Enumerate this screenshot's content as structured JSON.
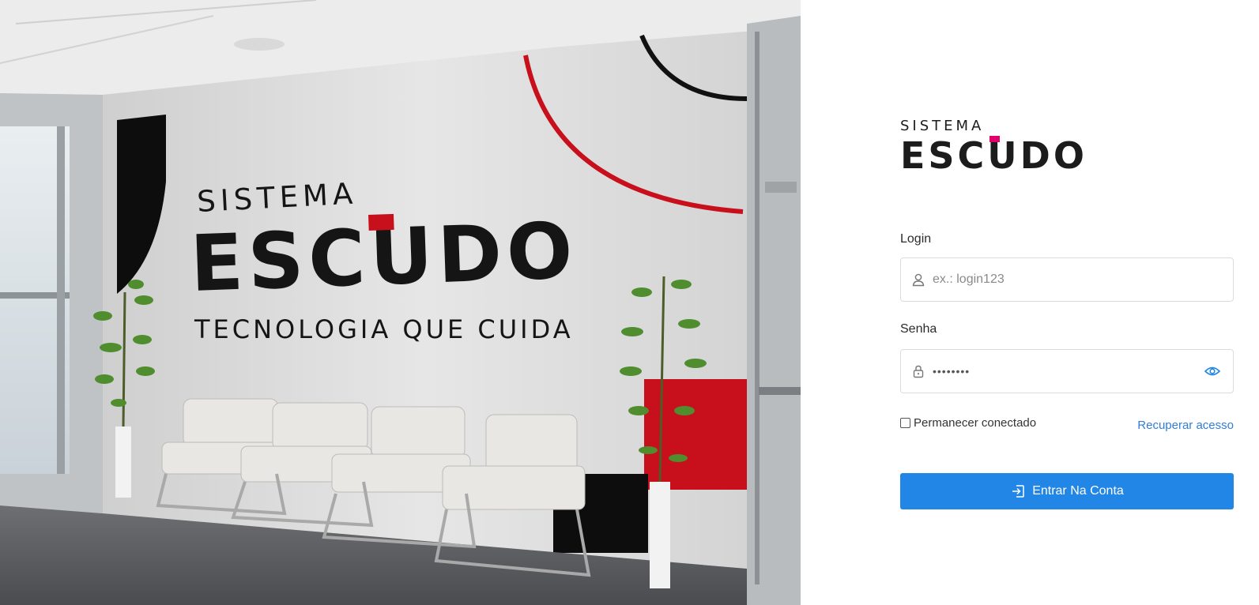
{
  "hero": {
    "wall_brand_small": "SISTEMA",
    "wall_brand_big": "ESCUDO",
    "wall_tagline": "TECNOLOGIA QUE CUIDA",
    "accent_red": "#c8101c"
  },
  "brand": {
    "small": "SISTEMA",
    "big": "ESCUDO",
    "mark_color": "#e2006a"
  },
  "form": {
    "login": {
      "label": "Login",
      "placeholder": "ex.: login123",
      "icon": "user-icon"
    },
    "senha": {
      "label": "Senha",
      "value_masked": "••••••••",
      "icon": "lock-icon",
      "toggle_icon": "eye-icon"
    },
    "remember_label": "Permanecer conectado",
    "recover_label": "Recuperar acesso",
    "submit_label": "Entrar Na Conta",
    "submit_icon": "sign-in-icon",
    "primary_color": "#2186e6",
    "link_color": "#2f7fd6"
  }
}
